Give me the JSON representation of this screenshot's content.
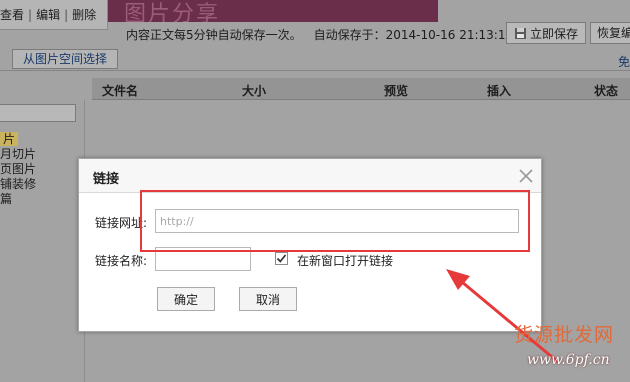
{
  "top_menu": {
    "view": "查看",
    "edit": "编辑",
    "delete": "删除"
  },
  "banner_text": "图片分享",
  "autosave": {
    "notice": "内容正文每5分钟自动保存一次。",
    "status": "自动保存于：2014-10-16 21:13:14"
  },
  "toolbar": {
    "save_now": "立即保存",
    "restore": "恢复编辑"
  },
  "tabs": {
    "picture_space": "从图片空间选择",
    "free": "免"
  },
  "file_table": {
    "columns": [
      "文件名",
      "大小",
      "预览",
      "插入",
      "状态"
    ]
  },
  "side_list": [
    "片",
    "月切片",
    "页图片",
    "铺装修",
    "篇"
  ],
  "dialog": {
    "title": "链接",
    "url_label": "链接网址:",
    "url_placeholder": "http://",
    "name_label": "链接名称:",
    "new_window_label": "在新窗口打开链接",
    "new_window_checked": true,
    "ok": "确定",
    "cancel": "取消"
  },
  "watermark": {
    "text": "货源批发网",
    "url": "www.6pf.cn"
  },
  "colors": {
    "annotation_red": "#e63a3a",
    "overlay_gray": "#a3a3a3",
    "dialog_bg": "#ffffff"
  }
}
